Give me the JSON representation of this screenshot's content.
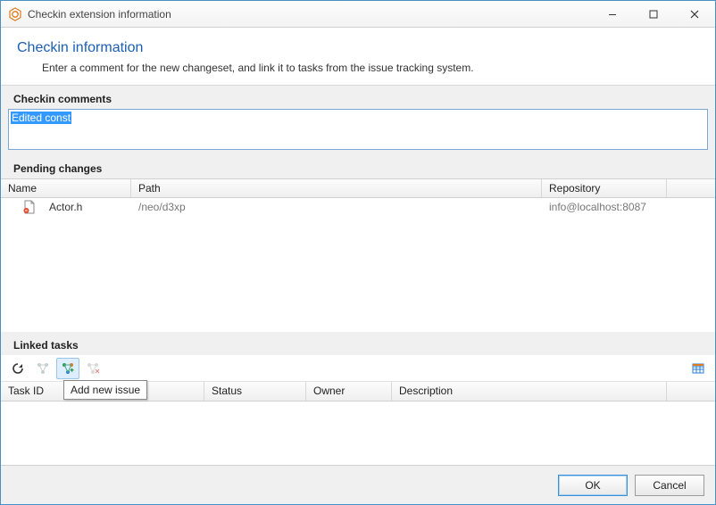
{
  "window": {
    "title": "Checkin extension information"
  },
  "header": {
    "title": "Checkin information",
    "subtitle": "Enter a comment for the new changeset, and link it to tasks from the issue tracking system."
  },
  "sections": {
    "comments_label": "Checkin comments",
    "pending_label": "Pending changes",
    "linked_label": "Linked tasks"
  },
  "comment": {
    "value_selected": "Edited const"
  },
  "pending": {
    "columns": {
      "name": "Name",
      "path": "Path",
      "repository": "Repository"
    },
    "rows": [
      {
        "name": "Actor.h",
        "path": "/neo/d3xp",
        "repository": "info@localhost:8087"
      }
    ]
  },
  "tasks": {
    "columns": {
      "id": "Task ID",
      "status": "Status",
      "owner": "Owner",
      "description": "Description"
    },
    "toolbar_tooltip": "Add new issue"
  },
  "buttons": {
    "ok": "OK",
    "cancel": "Cancel"
  }
}
